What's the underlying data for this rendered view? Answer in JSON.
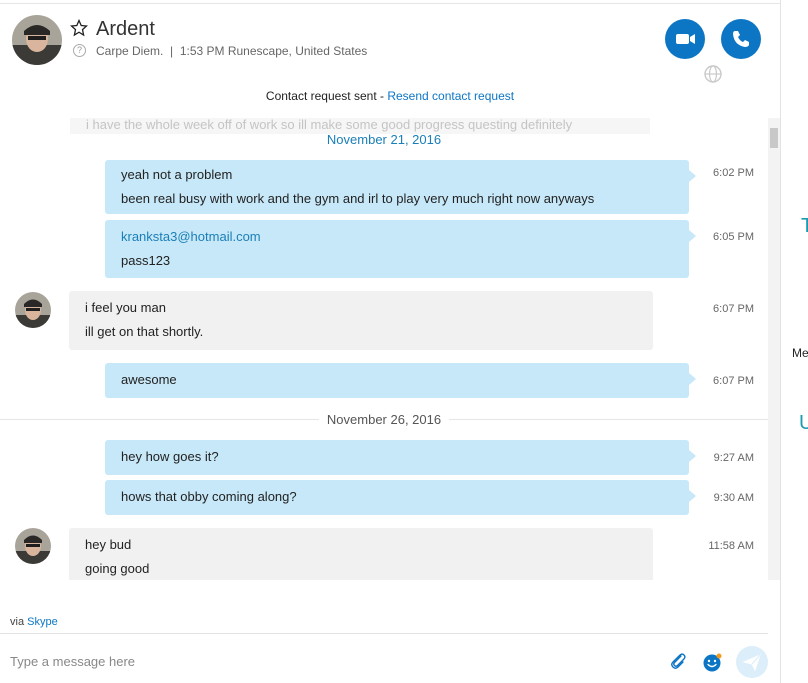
{
  "contact": {
    "name": "Ardent",
    "mood": "Carpe Diem.",
    "local_time_location": "1:53 PM Runescape, United States"
  },
  "contact_request": {
    "text": "Contact request sent - ",
    "link": "Resend contact request"
  },
  "faded_message": "i have the whole week off of work so ill make some good progress questing definitely",
  "dates": [
    {
      "label": "November 21, 2016",
      "color": "#1a7fb8"
    },
    {
      "label": "November 26, 2016",
      "color": "#555555"
    }
  ],
  "messages": [
    {
      "dir": "out",
      "lines": [
        "yeah not a problem",
        "been real busy with work and the gym and irl to play very much right now anyways"
      ],
      "time": "6:02 PM"
    },
    {
      "dir": "out",
      "lines": [
        "kranksta3@hotmail.com",
        "pass123"
      ],
      "time": "6:05 PM"
    },
    {
      "dir": "in",
      "lines": [
        "i feel you man",
        "ill get on that shortly."
      ],
      "time": "6:07 PM"
    },
    {
      "dir": "out",
      "lines": [
        "awesome"
      ],
      "time": "6:07 PM"
    },
    {
      "dir": "out",
      "lines": [
        "hey how goes it?"
      ],
      "time": "9:27 AM"
    },
    {
      "dir": "out",
      "lines": [
        "hows that obby coming along?"
      ],
      "time": "9:30 AM"
    },
    {
      "dir": "in",
      "lines": [
        "hey bud",
        "going good"
      ],
      "time": "11:58 AM"
    }
  ],
  "via": {
    "prefix": "via ",
    "link": "Skype"
  },
  "composer": {
    "placeholder": "Type a message here"
  },
  "right_pane": {
    "frag1": "T",
    "frag2": "Me",
    "frag3": "U"
  },
  "icons": {
    "favorite": "star-outline-icon",
    "video_call": "video-camera-icon",
    "audio_call": "phone-icon",
    "globe": "globe-icon",
    "attach": "paperclip-icon",
    "emoji": "smiley-icon",
    "send": "send-icon"
  },
  "colors": {
    "accent": "#0d76c4",
    "outgoing_bubble": "#c7e8f8",
    "incoming_bubble": "#f1f1f2",
    "link": "#1a7fb8",
    "right_pane_teal": "#1a9bb0"
  }
}
